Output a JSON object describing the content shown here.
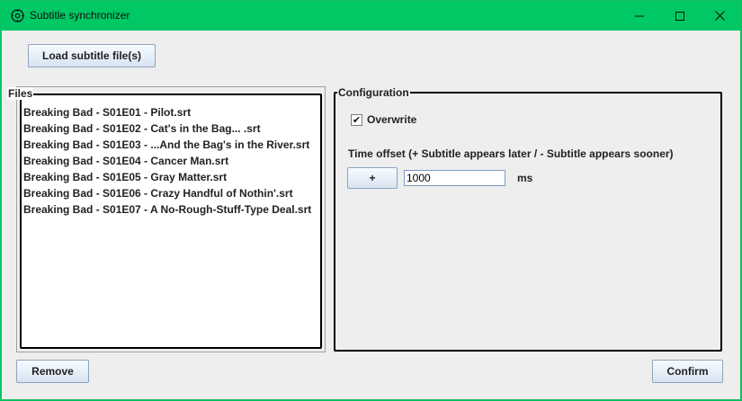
{
  "window": {
    "title": "Subtitle synchronizer",
    "icon": "synchronizer-gear-icon",
    "controls": [
      "minimize-icon",
      "maximize-icon",
      "close-icon"
    ],
    "accent_color": "#00c864"
  },
  "toolbar": {
    "load_label": "Load subtitle file(s)"
  },
  "files": {
    "legend": "Files",
    "items": [
      "Breaking Bad - S01E01 - Pilot.srt",
      "Breaking Bad - S01E02 - Cat's in the Bag... .srt",
      "Breaking Bad - S01E03 - ...And the Bag's in the River.srt",
      "Breaking Bad - S01E04 - Cancer Man.srt",
      "Breaking Bad - S01E05 - Gray Matter.srt",
      "Breaking Bad - S01E06 - Crazy Handful of Nothin'.srt",
      "Breaking Bad - S01E07 - A No-Rough-Stuff-Type Deal.srt"
    ]
  },
  "config": {
    "legend": "Configuration",
    "overwrite_label": "Overwrite",
    "overwrite_checked": true,
    "offset_label": "Time offset (+ Subtitle appears later / - Subtitle appears sooner)",
    "sign_label": "+",
    "offset_value": "1000",
    "unit": "ms"
  },
  "footer": {
    "remove_label": "Remove",
    "confirm_label": "Confirm"
  }
}
